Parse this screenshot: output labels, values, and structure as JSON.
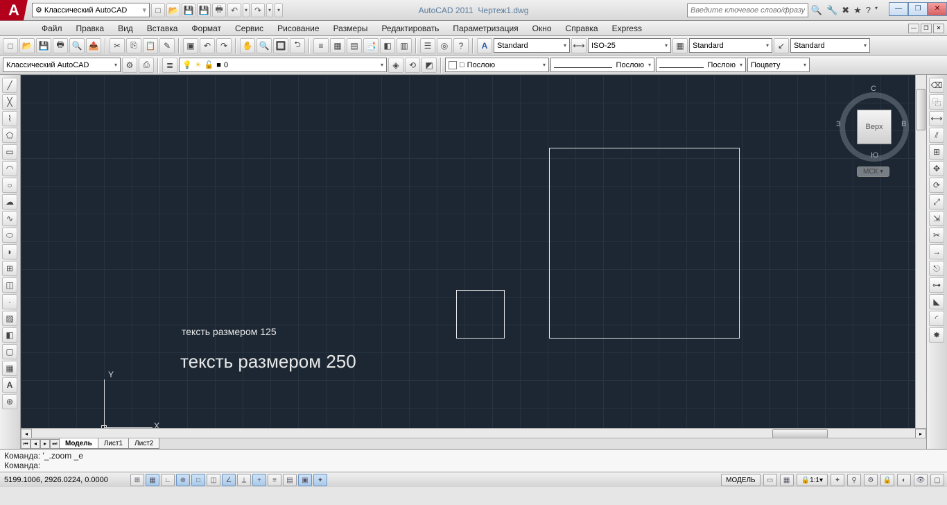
{
  "title": {
    "app": "AutoCAD 2011",
    "file": "Чертеж1.dwg"
  },
  "qat": {
    "workspace": "Классический AutoCAD"
  },
  "search": {
    "placeholder": "Введите ключевое слово/фразу"
  },
  "menu": [
    "Файл",
    "Правка",
    "Вид",
    "Вставка",
    "Формат",
    "Сервис",
    "Рисование",
    "Размеры",
    "Редактировать",
    "Параметризация",
    "Окно",
    "Справка",
    "Express"
  ],
  "styles": {
    "text_style": "Standard",
    "dim_style": "ISO-25",
    "table_style": "Standard",
    "mleader_style": "Standard"
  },
  "workspace_combo": "Классический AutoCAD",
  "layers": {
    "current": "0"
  },
  "props": {
    "color": "Послою",
    "lineweight": "Послою",
    "linetype": "Послою",
    "plotstyle": "Поцвету"
  },
  "viewcube": {
    "face": "Верх",
    "n": "С",
    "s": "Ю",
    "e": "В",
    "w": "З",
    "wcs": "МСК"
  },
  "canvas": {
    "text125": "тексть размером 125",
    "text250": "тексть размером 250",
    "ucs_x": "X",
    "ucs_y": "Y"
  },
  "tabs": {
    "model": "Модель",
    "layout1": "Лист1",
    "layout2": "Лист2"
  },
  "cmd": {
    "line1": "Команда: '_.zoom _e",
    "line2": "Команда:"
  },
  "status": {
    "coords": "5199.1006, 2926.0224, 0.0000",
    "model_btn": "МОДЕЛЬ",
    "scale": "1:1"
  }
}
